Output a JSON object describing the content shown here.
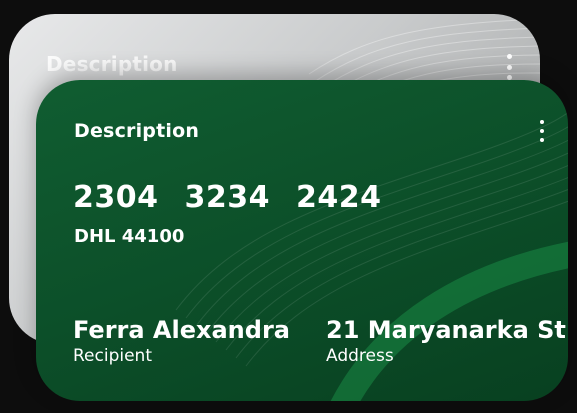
{
  "back_card": {
    "title": "Description"
  },
  "front_card": {
    "title": "Description",
    "number_groups": [
      "2304",
      "3234",
      "2424"
    ],
    "tracking_code": "DHL 44100",
    "recipient": {
      "value": "Ferra Alexandra",
      "label": "Recipient"
    },
    "address": {
      "value": "21 Maryanarka St",
      "label": "Address"
    }
  },
  "colors": {
    "background": "#0d0d0d",
    "front_card": "#0c4f29",
    "back_card": "#c9cbcc",
    "text": "#ffffff"
  }
}
